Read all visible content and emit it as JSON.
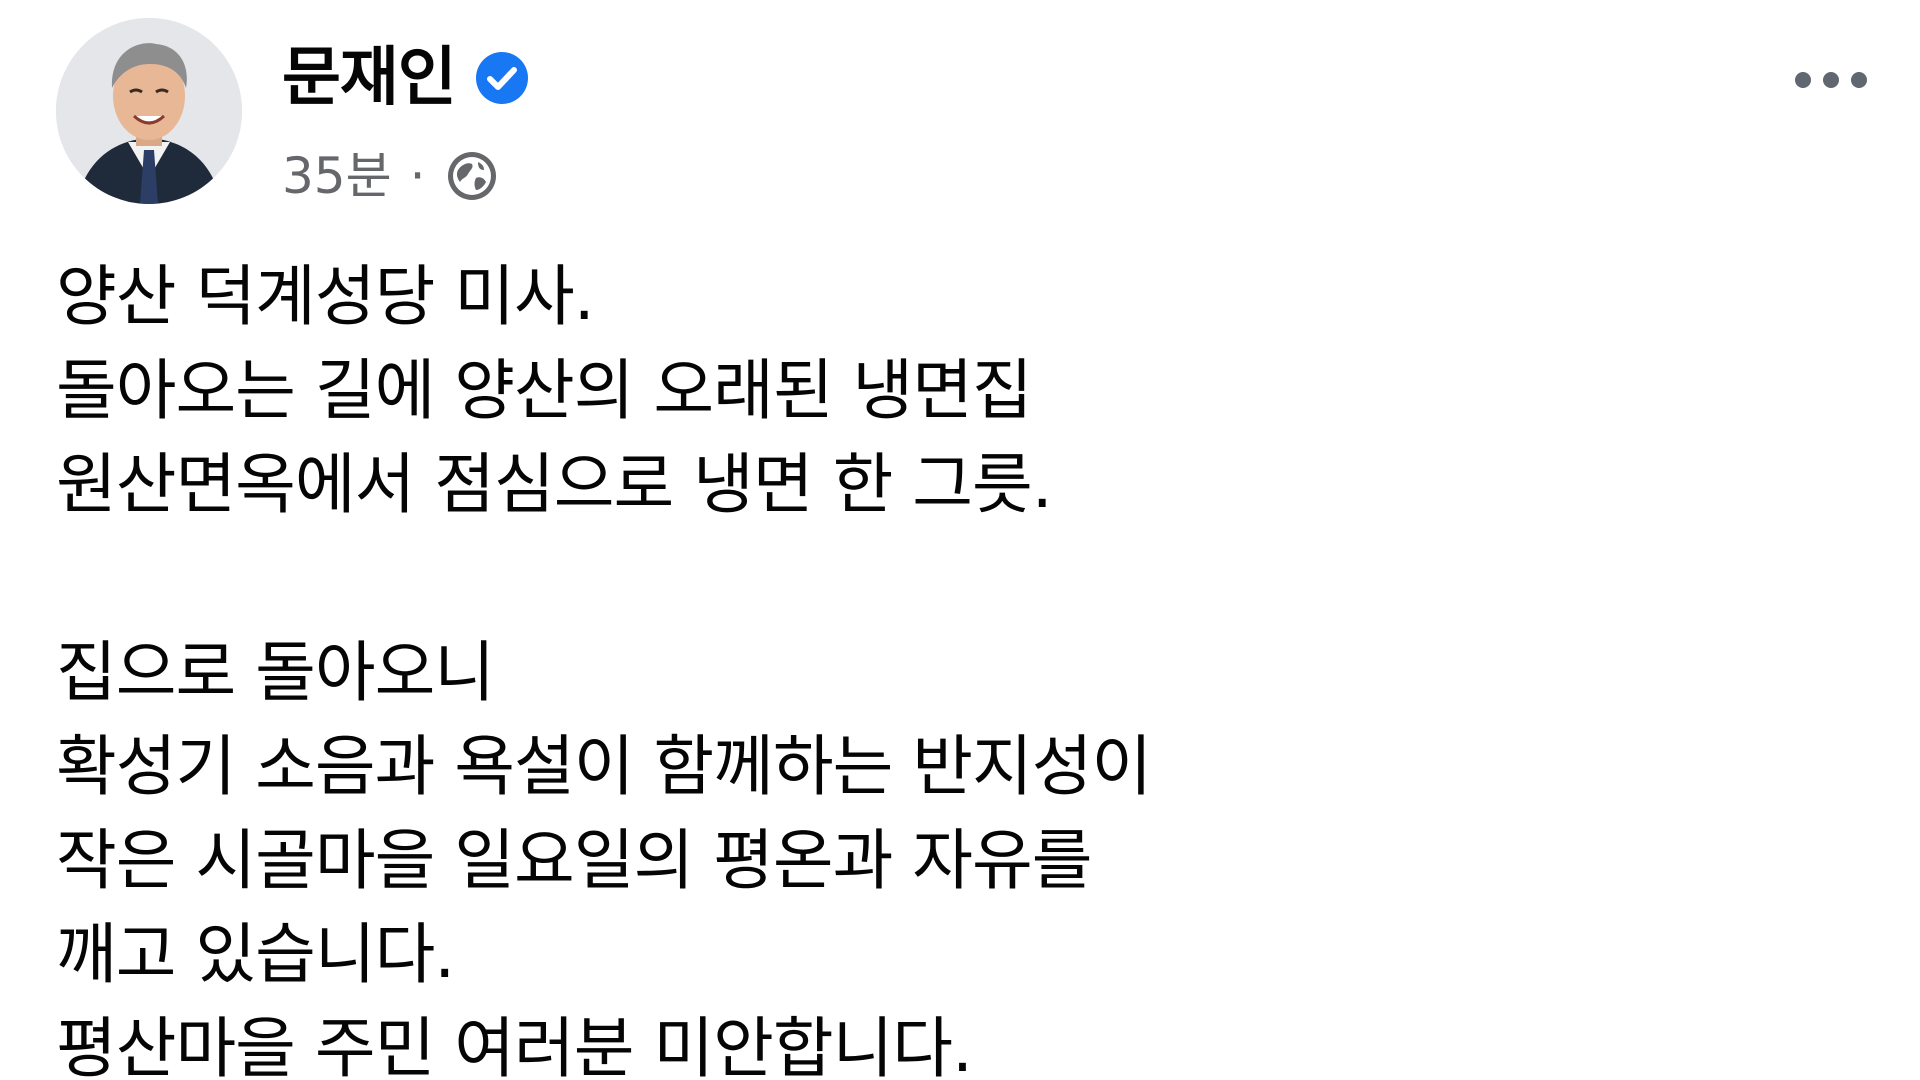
{
  "post": {
    "author": {
      "name": "문재인",
      "verified": true,
      "avatar_icon": "profile-photo"
    },
    "meta": {
      "timestamp": "35분",
      "separator": "·",
      "audience_icon": "globe-icon"
    },
    "menu_icon": "more-options-icon",
    "paragraph1": [
      "양산 덕계성당 미사.",
      "돌아오는 길에 양산의 오래된 냉면집",
      "원산면옥에서 점심으로 냉면 한 그릇."
    ],
    "paragraph2": [
      "집으로 돌아오니",
      "확성기 소음과 욕설이 함께하는 반지성이",
      "작은 시골마을 일요일의 평온과 자유를",
      "깨고 있습니다.",
      "평산마을 주민 여러분 미안합니다."
    ]
  },
  "colors": {
    "text": "#050505",
    "secondary_text": "#65676b",
    "verified_blue": "#1877f2",
    "background": "#ffffff"
  }
}
